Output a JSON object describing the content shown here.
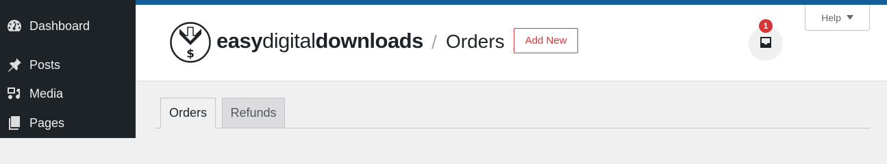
{
  "sidebar": {
    "items": [
      {
        "label": "Dashboard",
        "icon": "dashboard-icon"
      },
      {
        "label": "Posts",
        "icon": "pushpin-icon"
      },
      {
        "label": "Media",
        "icon": "media-icon"
      },
      {
        "label": "Pages",
        "icon": "pages-icon"
      }
    ]
  },
  "header": {
    "brand_easy": "easy",
    "brand_digital": "digital",
    "brand_downloads": "downloads",
    "separator": "/",
    "title": "Orders",
    "add_new_label": "Add New",
    "notification_count": "1",
    "help_label": "Help"
  },
  "tabs": [
    {
      "label": "Orders",
      "active": true
    },
    {
      "label": "Refunds",
      "active": false
    }
  ],
  "colors": {
    "sidebar_bg": "#1d2327",
    "top_strip": "#135e96",
    "accent_red": "#d63638",
    "content_bg": "#f0f0f1"
  }
}
